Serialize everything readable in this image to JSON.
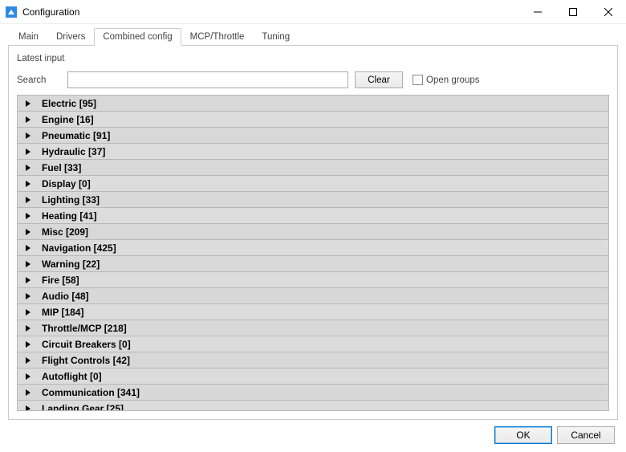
{
  "window": {
    "title": "Configuration",
    "icon_accent": "#2e8ae6"
  },
  "tabs": [
    {
      "label": "Main",
      "active": false
    },
    {
      "label": "Drivers",
      "active": false
    },
    {
      "label": "Combined config",
      "active": true
    },
    {
      "label": "MCP/Throttle",
      "active": false
    },
    {
      "label": "Tuning",
      "active": false
    }
  ],
  "panel": {
    "latest_label": "Latest input",
    "search_label": "Search",
    "search_value": "",
    "clear_label": "Clear",
    "open_groups_label": "Open groups",
    "open_groups_checked": false
  },
  "groups": [
    {
      "name": "Electric",
      "count": 95
    },
    {
      "name": "Engine",
      "count": 16
    },
    {
      "name": "Pneumatic",
      "count": 91
    },
    {
      "name": "Hydraulic",
      "count": 37
    },
    {
      "name": "Fuel",
      "count": 33
    },
    {
      "name": "Display",
      "count": 0
    },
    {
      "name": "Lighting",
      "count": 33
    },
    {
      "name": "Heating",
      "count": 41
    },
    {
      "name": "Misc",
      "count": 209
    },
    {
      "name": "Navigation",
      "count": 425
    },
    {
      "name": "Warning",
      "count": 22
    },
    {
      "name": "Fire",
      "count": 58
    },
    {
      "name": "Audio",
      "count": 48
    },
    {
      "name": "MIP",
      "count": 184
    },
    {
      "name": "Throttle/MCP",
      "count": 218
    },
    {
      "name": "Circuit Breakers",
      "count": 0
    },
    {
      "name": "Flight Controls",
      "count": 42
    },
    {
      "name": "Autoflight",
      "count": 0
    },
    {
      "name": "Communication",
      "count": 341
    },
    {
      "name": "Landing Gear",
      "count": 25
    }
  ],
  "footer": {
    "ok_label": "OK",
    "cancel_label": "Cancel"
  }
}
